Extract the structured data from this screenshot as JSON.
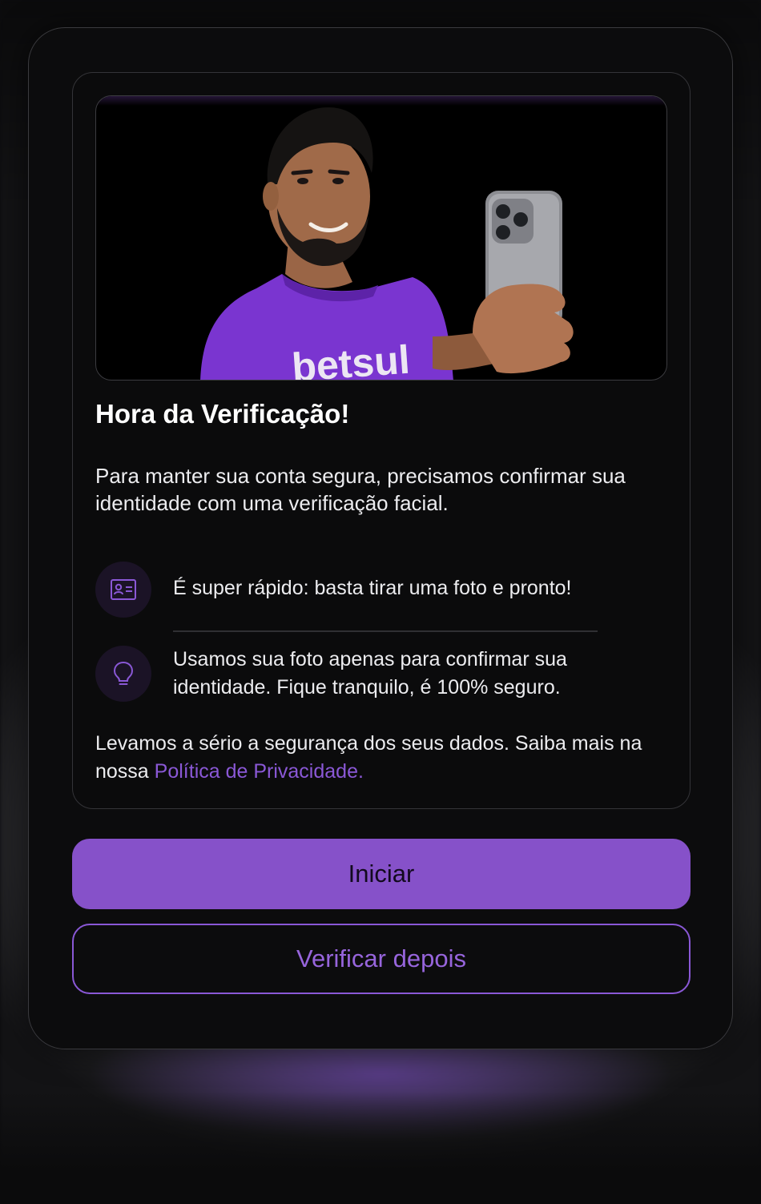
{
  "modal": {
    "title": "Hora da Verificação!",
    "intro": "Para manter sua conta segura, precisamos confirmar sua identidade com uma verificação facial.",
    "hero": {
      "shirt_text": "betsul",
      "shirt_color": "#7a35d0"
    },
    "features": [
      {
        "icon": "id-card-icon",
        "text": "É super rápido: basta tirar uma foto e pronto!"
      },
      {
        "icon": "lightbulb-icon",
        "text": "Usamos sua foto apenas para confirmar sua identidade. Fique tranquilo, é 100% seguro."
      }
    ],
    "privacy": {
      "text": "Levamos a sério a segurança dos seus dados. Saiba mais na nossa ",
      "link": "Política de Privacidade."
    },
    "buttons": {
      "primary": "Iniciar",
      "secondary": "Verificar depois"
    }
  },
  "colors": {
    "accent": "#8651c9",
    "link": "#8a58d6",
    "background": "#0c0c0d",
    "text": "#ececef"
  }
}
